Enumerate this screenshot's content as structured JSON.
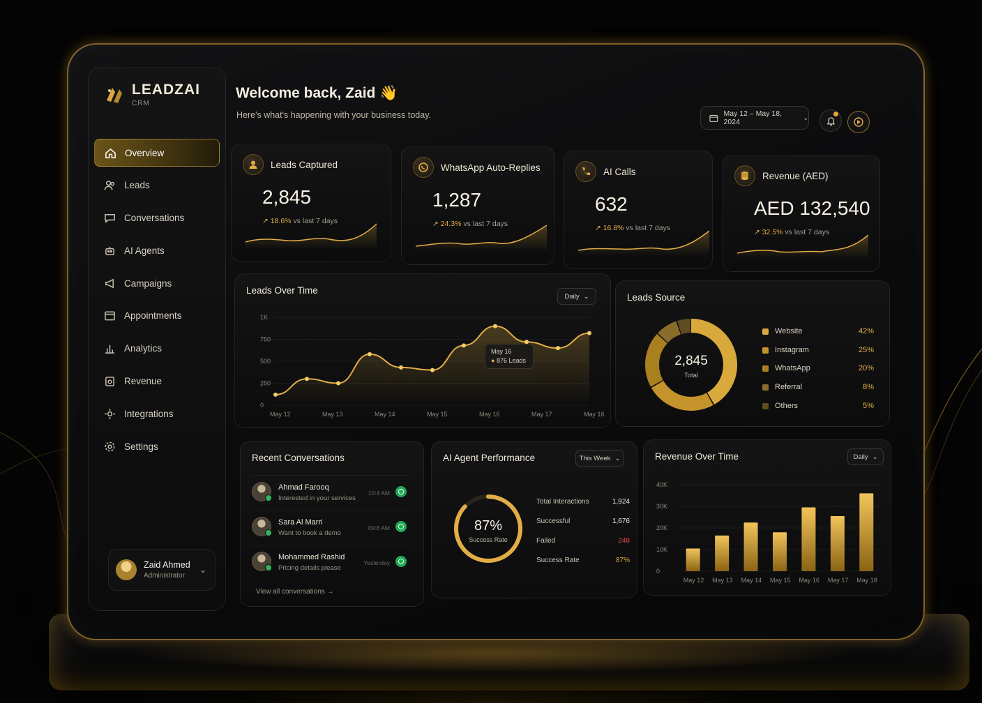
{
  "brand": {
    "name": "LEADZAI",
    "sub": "CRM"
  },
  "nav": [
    {
      "label": "Overview",
      "icon": "home-icon",
      "active": true
    },
    {
      "label": "Leads",
      "icon": "users-icon"
    },
    {
      "label": "Conversations",
      "icon": "chat-icon"
    },
    {
      "label": "AI Agents",
      "icon": "robot-icon"
    },
    {
      "label": "Campaigns",
      "icon": "megaphone-icon"
    },
    {
      "label": "Appointments",
      "icon": "calendar-icon"
    },
    {
      "label": "Analytics",
      "icon": "bar-chart-icon"
    },
    {
      "label": "Revenue",
      "icon": "wallet-icon"
    },
    {
      "label": "Integrations",
      "icon": "integrations-icon"
    },
    {
      "label": "Settings",
      "icon": "gear-icon"
    }
  ],
  "user": {
    "name": "Zaid Ahmed",
    "role": "Administrator"
  },
  "header": {
    "welcome": "Welcome back, Zaid 👋",
    "subtitle": "Here's what's happening with your business today.",
    "date_range": "May 12 – May 18, 2024"
  },
  "kpis": [
    {
      "title": "Leads Captured",
      "value": "2,845",
      "delta": "18.6%",
      "delta_suffix": "vs last 7 days",
      "icon": "user-icon"
    },
    {
      "title": "WhatsApp Auto-Replies",
      "value": "1,287",
      "delta": "24.3%",
      "delta_suffix": "vs last 7 days",
      "icon": "whatsapp-icon"
    },
    {
      "title": "AI Calls",
      "value": "632",
      "delta": "16.8%",
      "delta_suffix": "vs last 7 days",
      "icon": "phone-icon"
    },
    {
      "title": "Revenue (AED)",
      "value": "AED 132,540",
      "delta": "32.5%",
      "delta_suffix": "vs last 7 days",
      "icon": "coins-icon"
    }
  ],
  "leads_over_time": {
    "title": "Leads Over Time",
    "filter": "Daily",
    "tooltip": {
      "date": "May 16",
      "value": "876 Leads"
    },
    "chart_data": {
      "type": "line",
      "x": [
        "May 12",
        "",
        "May 13",
        "",
        "May 14",
        "",
        "May 15",
        "",
        "May 16",
        "",
        "May 17",
        "",
        "May 16"
      ],
      "xticks": [
        "May 12",
        "May 13",
        "May 14",
        "May 15",
        "May 16",
        "May 17",
        "May 16"
      ],
      "values": [
        120,
        300,
        250,
        580,
        430,
        400,
        680,
        900,
        720,
        650,
        820
      ],
      "yticks": [
        "0",
        "250",
        "500",
        "750",
        "1K"
      ],
      "ylim": [
        0,
        1000
      ]
    }
  },
  "leads_source": {
    "title": "Leads Source",
    "total": "2,845",
    "total_label": "Total",
    "chart_data": {
      "type": "pie",
      "labels": [
        "Website",
        "Instagram",
        "WhatsApp",
        "Referral",
        "Others"
      ],
      "values": [
        42,
        25,
        20,
        8,
        5
      ],
      "display": [
        "42%",
        "25%",
        "20%",
        "8%",
        "5%"
      ],
      "colors": [
        "#d9a93c",
        "#c4932c",
        "#a8801f",
        "#8a6c2a",
        "#5f4c22"
      ]
    }
  },
  "recent_conversations": {
    "title": "Recent Conversations",
    "items": [
      {
        "name": "Ahmad Farooq",
        "message": "Interested in your services",
        "time": "10:4 AM"
      },
      {
        "name": "Sara Al Marri",
        "message": "Want to book a demo",
        "time": "09:8 AM"
      },
      {
        "name": "Mohammed Rashid",
        "message": "Pricing details please",
        "time": "Yesterday"
      }
    ],
    "view_all": "View all conversations →"
  },
  "ai_agent": {
    "title": "AI Agent Performance",
    "filter": "This Week",
    "ring_value": "87%",
    "ring_label": "Success Rate",
    "ring_fraction": 0.87,
    "stats": [
      {
        "label": "Total Interactions",
        "value": "1,924",
        "color": "#f0ead9"
      },
      {
        "label": "Successful",
        "value": "1,676",
        "color": "#f0ead9"
      },
      {
        "label": "Failed",
        "value": "248",
        "color": "#e5484d"
      },
      {
        "label": "Success Rate",
        "value": "87%",
        "color": "#e3ad46"
      }
    ]
  },
  "revenue_over_time": {
    "title": "Revenue Over Time",
    "filter": "Daily",
    "chart_data": {
      "type": "bar",
      "categories": [
        "May 12",
        "May 13",
        "May 14",
        "May 15",
        "May 16",
        "May 17",
        "May 18"
      ],
      "values": [
        10500,
        16500,
        22500,
        18000,
        29500,
        25500,
        36000
      ],
      "yticks": [
        "0",
        "10K",
        "20K",
        "30K",
        "40K"
      ],
      "ylim": [
        0,
        40000
      ]
    }
  }
}
